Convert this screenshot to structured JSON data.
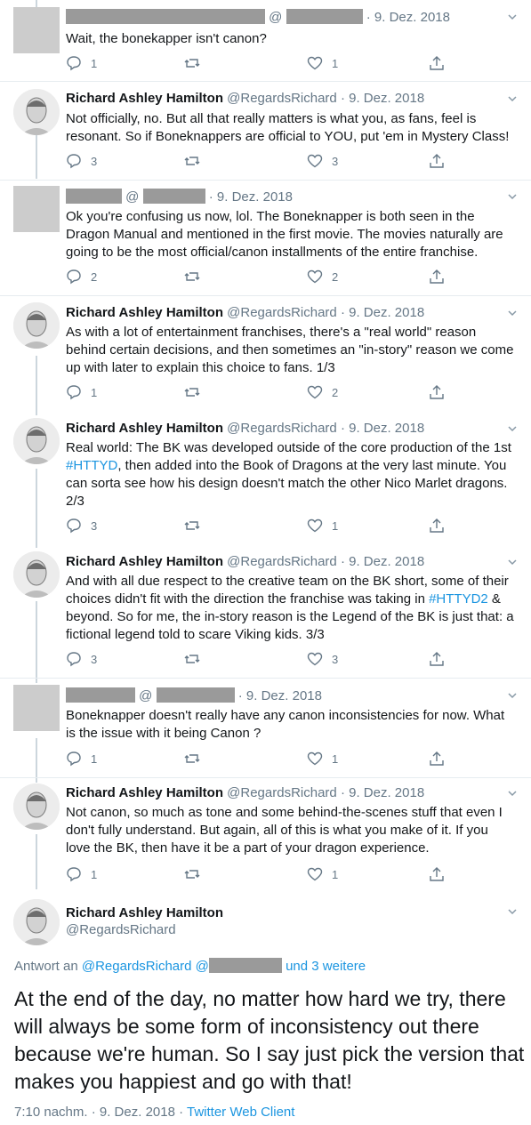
{
  "tweets": [
    {
      "name": "",
      "handle_prefix": "@",
      "date": "· 9. Dez. 2018",
      "text": "Wait, the bonekapper isn't canon?",
      "replies": "1",
      "retweets": "",
      "likes": "1"
    },
    {
      "name": "Richard Ashley Hamilton",
      "handle": "@RegardsRichard",
      "date": "· 9. Dez. 2018",
      "text": "Not officially, no. But all that really matters is what you, as fans, feel is resonant. So if Boneknappers are official to YOU, put 'em in Mystery Class!",
      "replies": "3",
      "retweets": "",
      "likes": "3"
    },
    {
      "name": "",
      "handle_prefix": "@",
      "date": "· 9. Dez. 2018",
      "text": "Ok you're confusing us now, lol. The Boneknapper is both seen in the Dragon Manual and mentioned in the first movie. The movies naturally are going to be the most official/canon installments of the entire franchise.",
      "replies": "2",
      "retweets": "",
      "likes": "2"
    },
    {
      "name": "Richard Ashley Hamilton",
      "handle": "@RegardsRichard",
      "date": "· 9. Dez. 2018",
      "text": "As with a lot of entertainment franchises, there's a \"real world\" reason behind certain decisions, and then sometimes an \"in-story\" reason we come up with later to explain this choice to fans. 1/3",
      "replies": "1",
      "retweets": "",
      "likes": "2"
    },
    {
      "name": "Richard Ashley Hamilton",
      "handle": "@RegardsRichard",
      "date": "· 9. Dez. 2018",
      "text_parts": [
        "Real world: The BK was developed outside of the core production of the 1st ",
        "#HTTYD",
        ", then added into the Book of Dragons at the very last minute. You can sorta see how his design doesn't match the other Nico Marlet dragons. 2/3"
      ],
      "replies": "3",
      "retweets": "",
      "likes": "1"
    },
    {
      "name": "Richard Ashley Hamilton",
      "handle": "@RegardsRichard",
      "date": "· 9. Dez. 2018",
      "text_parts": [
        "And with all due respect to the creative team on the BK short, some of their choices didn't fit with the direction the franchise was taking in ",
        "#HTTYD2",
        " & beyond. So for me, the in-story reason is the Legend of the BK is just that: a fictional legend told to scare Viking kids. 3/3"
      ],
      "replies": "3",
      "retweets": "",
      "likes": "3"
    },
    {
      "name": "",
      "handle_prefix": "@",
      "date": "· 9. Dez. 2018",
      "text": "Boneknapper doesn't really have any canon inconsistencies for now. What is the issue with it being Canon ?",
      "replies": "1",
      "retweets": "",
      "likes": "1"
    },
    {
      "name": "Richard Ashley Hamilton",
      "handle": "@RegardsRichard",
      "date": "· 9. Dez. 2018",
      "text": "Not canon, so much as tone and some behind-the-scenes stuff that even I don't fully understand. But again, all of this is what you make of it. If you love the BK, then have it be a part of your dragon experience.",
      "replies": "1",
      "retweets": "",
      "likes": "1"
    }
  ],
  "main": {
    "name": "Richard Ashley Hamilton",
    "handle": "@RegardsRichard",
    "reply_prefix": "Antwort an ",
    "reply_handle": "@RegardsRichard",
    "reply_at": " @",
    "reply_suffix": "und 3 weitere",
    "text": "At the end of the day, no matter how hard we try, there will always be some form of inconsistency out there because we're human. So I say just pick the version that makes you happiest and go with that!",
    "time": "7:10 nachm. · 9. Dez. 2018 · ",
    "client": "Twitter Web Client"
  },
  "colors": {
    "link": "#1b95e0",
    "muted": "#657786",
    "text": "#14171a",
    "redaction": "#9a9a9a"
  }
}
